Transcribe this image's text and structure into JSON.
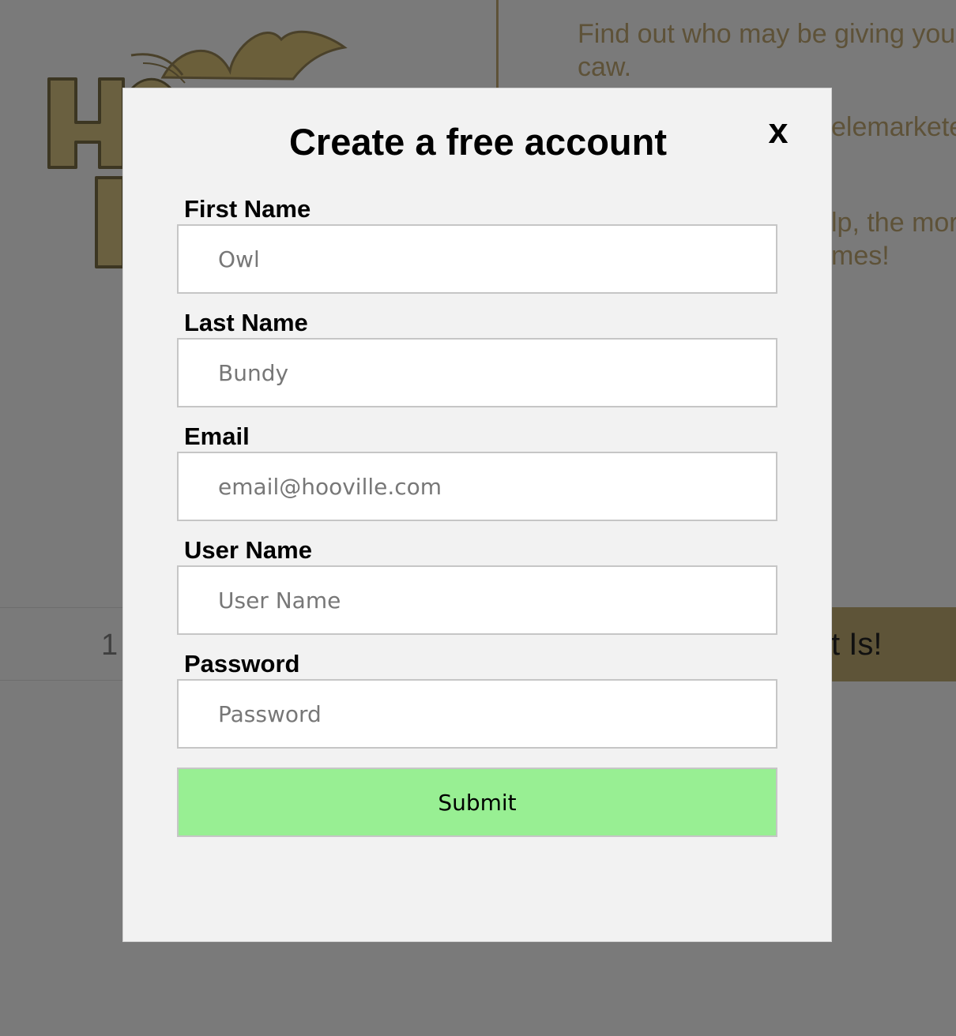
{
  "background": {
    "logo": {
      "icon": "owl-logo-icon",
      "letters": "HOO"
    },
    "intro_text": "Find out who may be giving you the caw.",
    "partial_text_1": "elemarketers",
    "partial_text_2_line1": "lp, the more",
    "partial_text_2_line2": "mes!",
    "bar_number": "1",
    "bar_button_label": "t Is!",
    "colors": {
      "overlay": "#7a7a7a",
      "brand_brown": "#5e5238"
    }
  },
  "modal": {
    "title": "Create a free account",
    "close_label": "x",
    "fields": [
      {
        "label": "First Name",
        "placeholder": "Owl",
        "value": ""
      },
      {
        "label": "Last Name",
        "placeholder": "Bundy",
        "value": ""
      },
      {
        "label": "Email",
        "placeholder": "email@hooville.com",
        "value": ""
      },
      {
        "label": "User Name",
        "placeholder": "User Name",
        "value": ""
      },
      {
        "label": "Password",
        "placeholder": "Password",
        "value": ""
      }
    ],
    "submit_label": "Submit",
    "colors": {
      "background": "#f2f2f2",
      "submit": "#98ef93"
    }
  }
}
